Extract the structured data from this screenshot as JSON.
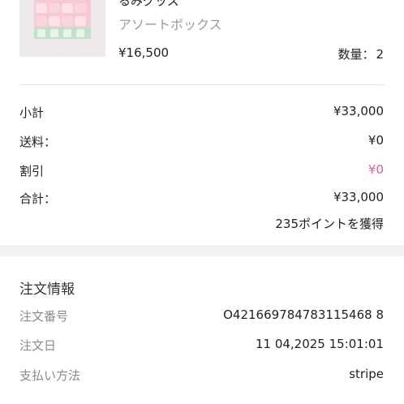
{
  "product": {
    "name_partial": "るみグッズ",
    "variant": "アソートボックス",
    "price": "¥16,500",
    "quantity_label": "数量：",
    "quantity_value": "2",
    "image_icon": "product-image"
  },
  "summary": {
    "subtotal_label": "小計",
    "subtotal_value": "¥33,000",
    "shipping_label": "送料：",
    "shipping_value": "¥0",
    "discount_label": "割引",
    "discount_value": "¥0",
    "total_label": "合計：",
    "total_value": "¥33,000",
    "points_text": "235ポイントを獲得"
  },
  "order_info": {
    "title": "注文情報",
    "number_label": "注文番号",
    "number_value": "O421669784783115468 8",
    "date_label": "注文日",
    "date_value": "11 04,2025 15:01:01",
    "payment_label": "支払い方法",
    "payment_value": "stripe"
  },
  "colors": {
    "discount": "#e0607e",
    "label_gray": "#8a8a8a",
    "variant_gray": "#9a9a9a",
    "page_bg": "#f2f2f2"
  }
}
